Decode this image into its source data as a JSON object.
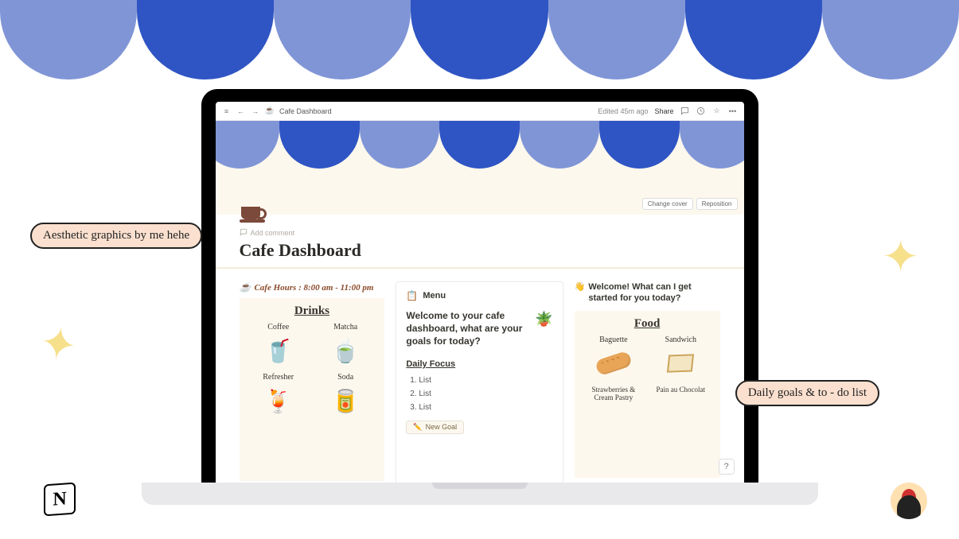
{
  "outer_decor": {
    "callout_left": "Aesthetic graphics by me hehe",
    "callout_right": "Daily goals & to - do list",
    "notion_logo": "N"
  },
  "topbar": {
    "menu_icon": "≡",
    "back_icon": "←",
    "fwd_icon": "→",
    "page_emoji": "☕",
    "breadcrumb": "Cafe Dashboard",
    "edited": "Edited 45m ago",
    "share": "Share",
    "comment_icon": "💬",
    "clock_icon": "🕘",
    "star_icon": "☆",
    "more_icon": "•••"
  },
  "cover": {
    "change_cover": "Change cover",
    "reposition": "Reposition"
  },
  "header": {
    "add_comment_icon": "💬",
    "add_comment": "Add comment",
    "title": "Cafe Dashboard"
  },
  "left": {
    "hours_emoji": "☕",
    "hours": "Cafe Hours : 8:00 am - 11:00 pm",
    "panel_title": "Drinks",
    "items": [
      {
        "label": "Coffee",
        "emoji": "🥤"
      },
      {
        "label": "Matcha",
        "emoji": "🍵"
      },
      {
        "label": "Refresher",
        "emoji": "🍹"
      },
      {
        "label": "Soda",
        "emoji": "🥫"
      }
    ]
  },
  "mid": {
    "menu_icon": "📋",
    "menu_label": "Menu",
    "welcome": "Welcome to your cafe dashboard, what are your goals for today?",
    "plant": "🪴",
    "focus_title": "Daily Focus",
    "focus_items": [
      "List",
      "List",
      "List"
    ],
    "new_goal_icon": "✏️",
    "new_goal": "New Goal"
  },
  "right": {
    "wave": "👋",
    "welcome": "Welcome! What can I get started for you today?",
    "panel_title": "Food",
    "items": [
      {
        "label": "Baguette"
      },
      {
        "label": "Sandwich"
      },
      {
        "label": "Strawberries & Cream Pastry"
      },
      {
        "label": "Pain au Chocolat"
      }
    ],
    "help": "?"
  }
}
